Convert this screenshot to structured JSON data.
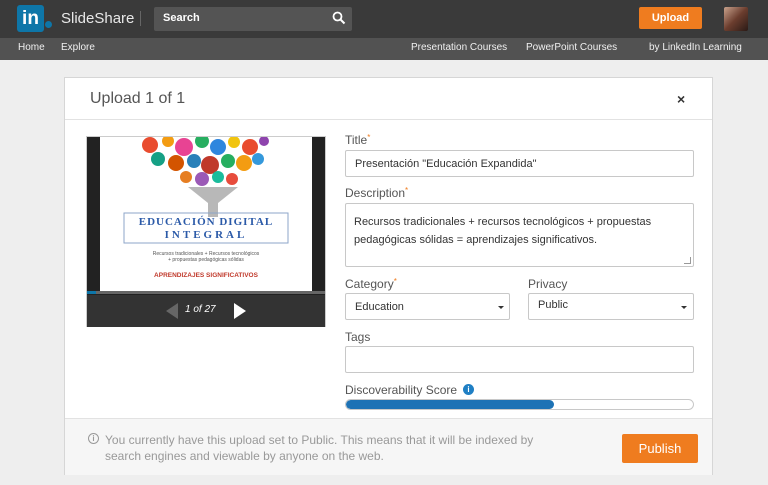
{
  "header": {
    "logo_badge": "in",
    "brand": "SlideShare",
    "search_label": "Search",
    "upload_label": "Upload"
  },
  "subnav": {
    "home": "Home",
    "explore": "Explore",
    "presentation_courses": "Presentation Courses",
    "powerpoint_courses": "PowerPoint Courses",
    "linkedin_learning": "by LinkedIn Learning"
  },
  "modal": {
    "title": "Upload 1 of 1",
    "close_glyph": "×",
    "preview": {
      "slide": {
        "title_line1": "EDUCACIÓN DIGITAL",
        "title_line2": "INTEGRAL",
        "subtitle_line1": "Recursos tradicionales + Recursos tecnológicos",
        "subtitle_line2": "+ propuestas pedagógicas sólidas",
        "bottom_text": "APRENDIZAJES SIGNIFICATIVOS"
      },
      "page_count": "1 of 27",
      "progress_fraction": 0.037
    },
    "form": {
      "title_label": "Title",
      "title_value": "Presentación \"Educación Expandida\"",
      "description_label": "Description",
      "description_value": "Recursos tradicionales + recursos tecnológicos + propuestas pedagógicas sólidas = aprendizajes significativos.",
      "category_label": "Category",
      "category_value": "Education",
      "privacy_label": "Privacy",
      "privacy_value": "Public",
      "tags_label": "Tags",
      "tags_value": "",
      "score_label": "Discoverability Score",
      "score_fraction": 0.6,
      "required_marker": "*"
    },
    "footer": {
      "notice": "You currently have this upload set to Public. This means that it will be indexed by search engines and viewable by anyone on the web.",
      "publish_label": "Publish"
    }
  },
  "colors": {
    "accent_orange": "#ef7c1f",
    "linkedin_blue": "#0e76a8",
    "score_blue": "#1d72b5"
  }
}
